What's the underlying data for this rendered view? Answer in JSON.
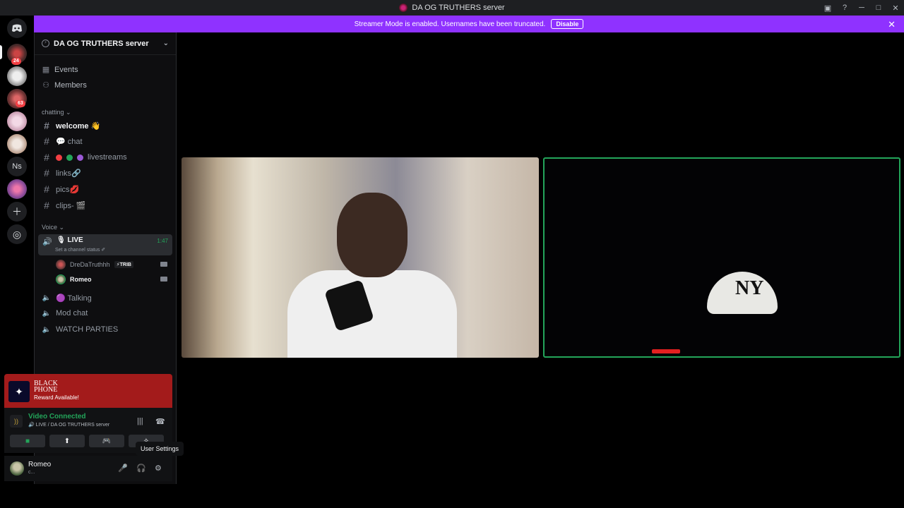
{
  "window": {
    "title": "DA OG TRUTHERS server"
  },
  "banner": {
    "text": "Streamer Mode is enabled. Usernames have been truncated.",
    "button": "Disable"
  },
  "rail": {
    "badges": [
      "24",
      "63"
    ],
    "ns_label": "Ns"
  },
  "server": {
    "name": "DA OG TRUTHERS server",
    "nav": [
      {
        "label": "Events",
        "icon": "calendar-icon"
      },
      {
        "label": "Members",
        "icon": "members-icon"
      }
    ],
    "categories": {
      "text": "chatting",
      "voice": "Voice"
    },
    "channels": [
      {
        "label": "welcome 👋"
      },
      {
        "label": "💬 chat"
      },
      {
        "label": "livestreams"
      },
      {
        "label": "links🔗"
      },
      {
        "label": "pics💋"
      },
      {
        "label": "clips- 🎬"
      }
    ],
    "voice_live": {
      "name": "🎙 LIVE",
      "status": "Set a channel status ✐",
      "time": "1:47"
    },
    "voice_users": [
      {
        "name": "DreDaTruthhh",
        "tag": "⚡TRIB"
      },
      {
        "name": "Romeo"
      }
    ],
    "voice_channels": [
      {
        "label": "🟣 Talking"
      },
      {
        "label": "Mod chat"
      },
      {
        "label": "WATCH PARTIES"
      }
    ]
  },
  "promo": {
    "title": "BLACK PHONE",
    "subtitle": "Reward Available!"
  },
  "voice": {
    "title": "Video Connected",
    "subtitle": "🔊 LIVE / DA OG TRUTHERS server"
  },
  "tooltip": "User Settings",
  "user": {
    "name": "Romeo",
    "status": "c..."
  },
  "colors": {
    "accent": "#8f32ff",
    "live_green": "#23a55a",
    "promo_red": "#a31b1b"
  }
}
